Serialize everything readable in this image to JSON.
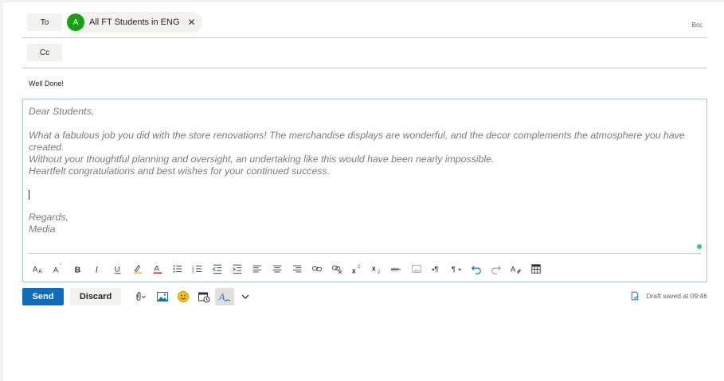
{
  "to": {
    "button_label": "To",
    "recipient": {
      "initial": "A",
      "name": "All FT Students in ENG",
      "avatar_color": "#13a10e"
    },
    "bcc_label": "Bcc"
  },
  "cc": {
    "button_label": "Cc"
  },
  "subject": "Well Done!",
  "body": {
    "greeting": "Dear Students,",
    "line1": "What a fabulous job you did with the store renovations! The merchandise displays are wonderful, and the decor complements the atmosphere you have created.",
    "line2": "Without your thoughtful planning and oversight, an undertaking like this would have been nearly impossible.",
    "line3": "Heartfelt congratulations and best wishes for your continued success.",
    "closing": "Regards,",
    "signature": "Media"
  },
  "format_toolbar": [
    "font-size-icon",
    "decrease-font-icon",
    "bold-icon",
    "italic-icon",
    "underline-icon",
    "highlight-icon",
    "font-color-icon",
    "bullets-icon",
    "numbering-icon",
    "decrease-indent-icon",
    "increase-indent-icon",
    "align-left-icon",
    "align-center-icon",
    "align-right-icon",
    "link-icon",
    "unlink-icon",
    "superscript-icon",
    "subscript-icon",
    "strikethrough-icon",
    "image-icon",
    "ltr-icon",
    "rtl-icon",
    "undo-icon",
    "redo-icon",
    "clear-format-icon",
    "table-icon"
  ],
  "actions": {
    "send_label": "Send",
    "discard_label": "Discard",
    "draft_status": "Draft saved at 09:46"
  },
  "colors": {
    "accent": "#0f6cbd",
    "avatar": "#13a10e",
    "status_dot": "#3cc18a"
  }
}
